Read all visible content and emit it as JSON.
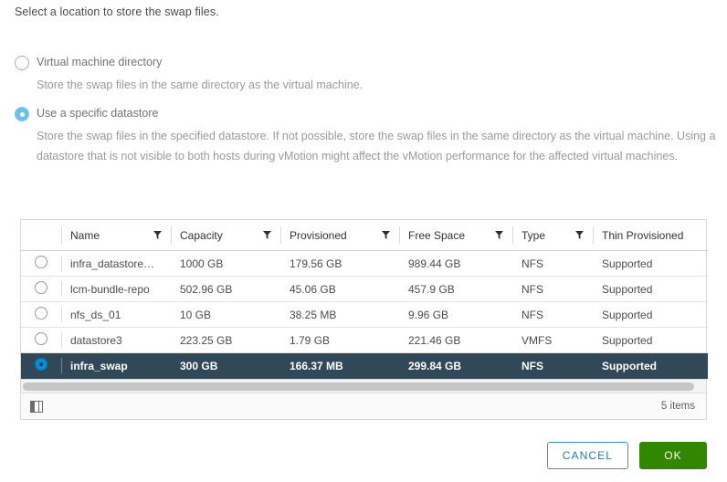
{
  "intro": {
    "text": "Select a location to store the swap files."
  },
  "options": [
    {
      "id": "vm-directory",
      "label": "Virtual machine directory",
      "selected": false,
      "description": "Store the swap files in the same directory as the virtual machine."
    },
    {
      "id": "specific-datastore",
      "label": "Use a specific datastore",
      "selected": true,
      "description": "Store the swap files in the specified datastore. If not possible, store the swap files in the same directory as the virtual machine. Using a datastore that is not visible to both hosts during vMotion might affect the vMotion performance for the affected virtual machines."
    }
  ],
  "table": {
    "columns": [
      {
        "label": "Name",
        "filter": true
      },
      {
        "label": "Capacity",
        "filter": true
      },
      {
        "label": "Provisioned",
        "filter": true
      },
      {
        "label": "Free Space",
        "filter": true
      },
      {
        "label": "Type",
        "filter": true
      },
      {
        "label": "Thin Provisioned",
        "filter": false
      }
    ],
    "rows": [
      {
        "selected": false,
        "name": "infra_datastore…",
        "capacity": "1000 GB",
        "provisioned": "179.56 GB",
        "free_space": "989.44 GB",
        "type": "NFS",
        "thin_provisioned": "Supported"
      },
      {
        "selected": false,
        "name": "lcm-bundle-repo",
        "capacity": "502.96 GB",
        "provisioned": "45.06 GB",
        "free_space": "457.9 GB",
        "type": "NFS",
        "thin_provisioned": "Supported"
      },
      {
        "selected": false,
        "name": "nfs_ds_01",
        "capacity": "10 GB",
        "provisioned": "38.25 MB",
        "free_space": "9.96 GB",
        "type": "NFS",
        "thin_provisioned": "Supported"
      },
      {
        "selected": false,
        "name": "datastore3",
        "capacity": "223.25 GB",
        "provisioned": "1.79 GB",
        "free_space": "221.46 GB",
        "type": "VMFS",
        "thin_provisioned": "Supported"
      },
      {
        "selected": true,
        "name": "infra_swap",
        "capacity": "300 GB",
        "provisioned": "166.37 MB",
        "free_space": "299.84 GB",
        "type": "NFS",
        "thin_provisioned": "Supported"
      }
    ],
    "footer": {
      "column_picker_icon": "columns-icon",
      "items_count": "5 items"
    }
  },
  "footer_buttons": {
    "cancel_label": "CANCEL",
    "ok_label": "OK"
  },
  "colors": {
    "selected_row": "#314859",
    "ok_button": "#318700",
    "cancel_border": "#3e95c8",
    "radio_on": "#69c0ea",
    "row_radio_checked": "#0090d9"
  }
}
